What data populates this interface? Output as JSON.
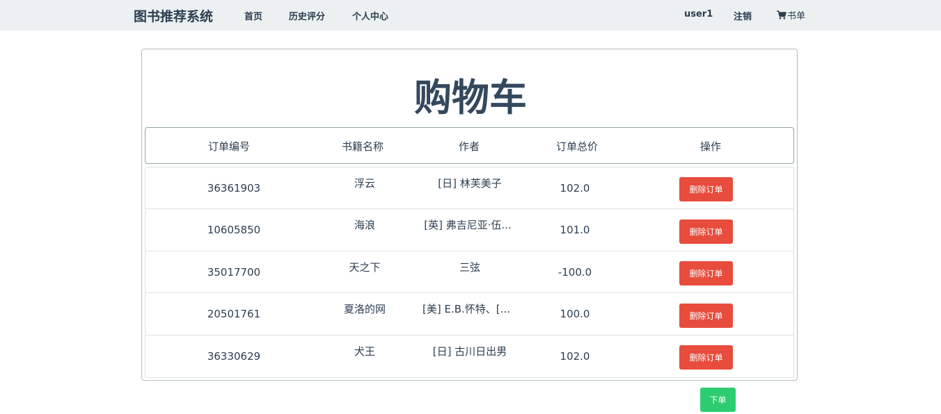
{
  "navbar": {
    "brand": "图书推荐系统",
    "links": [
      "首页",
      "历史评分",
      "个人中心"
    ],
    "username": "user1",
    "logout": "注销",
    "cart": "书单"
  },
  "page": {
    "title": "购物车",
    "columns": [
      "订单编号",
      "书籍名称",
      "作者",
      "订单总价",
      "操作"
    ],
    "rows": [
      {
        "order_id": "36361903",
        "book": "浮云",
        "author": "[日] 林芙美子",
        "total": "102.0",
        "action": "删除订单"
      },
      {
        "order_id": "10605850",
        "book": "海浪",
        "author": "[英] 弗吉尼亚·伍...",
        "total": "101.0",
        "action": "删除订单"
      },
      {
        "order_id": "35017700",
        "book": "天之下",
        "author": "三弦",
        "total": "-100.0",
        "action": "删除订单"
      },
      {
        "order_id": "20501761",
        "book": "夏洛的网",
        "author": "[美] E.B.怀特、[...",
        "total": "100.0",
        "action": "删除订单"
      },
      {
        "order_id": "36330629",
        "book": "犬王",
        "author": "[日] 古川日出男",
        "total": "102.0",
        "action": "删除订单"
      }
    ],
    "submit": "下单"
  },
  "colors": {
    "navbar_bg": "#ecf0f1",
    "text": "#2c3e50",
    "danger": "#e74c3c",
    "success": "#2ecc71"
  }
}
